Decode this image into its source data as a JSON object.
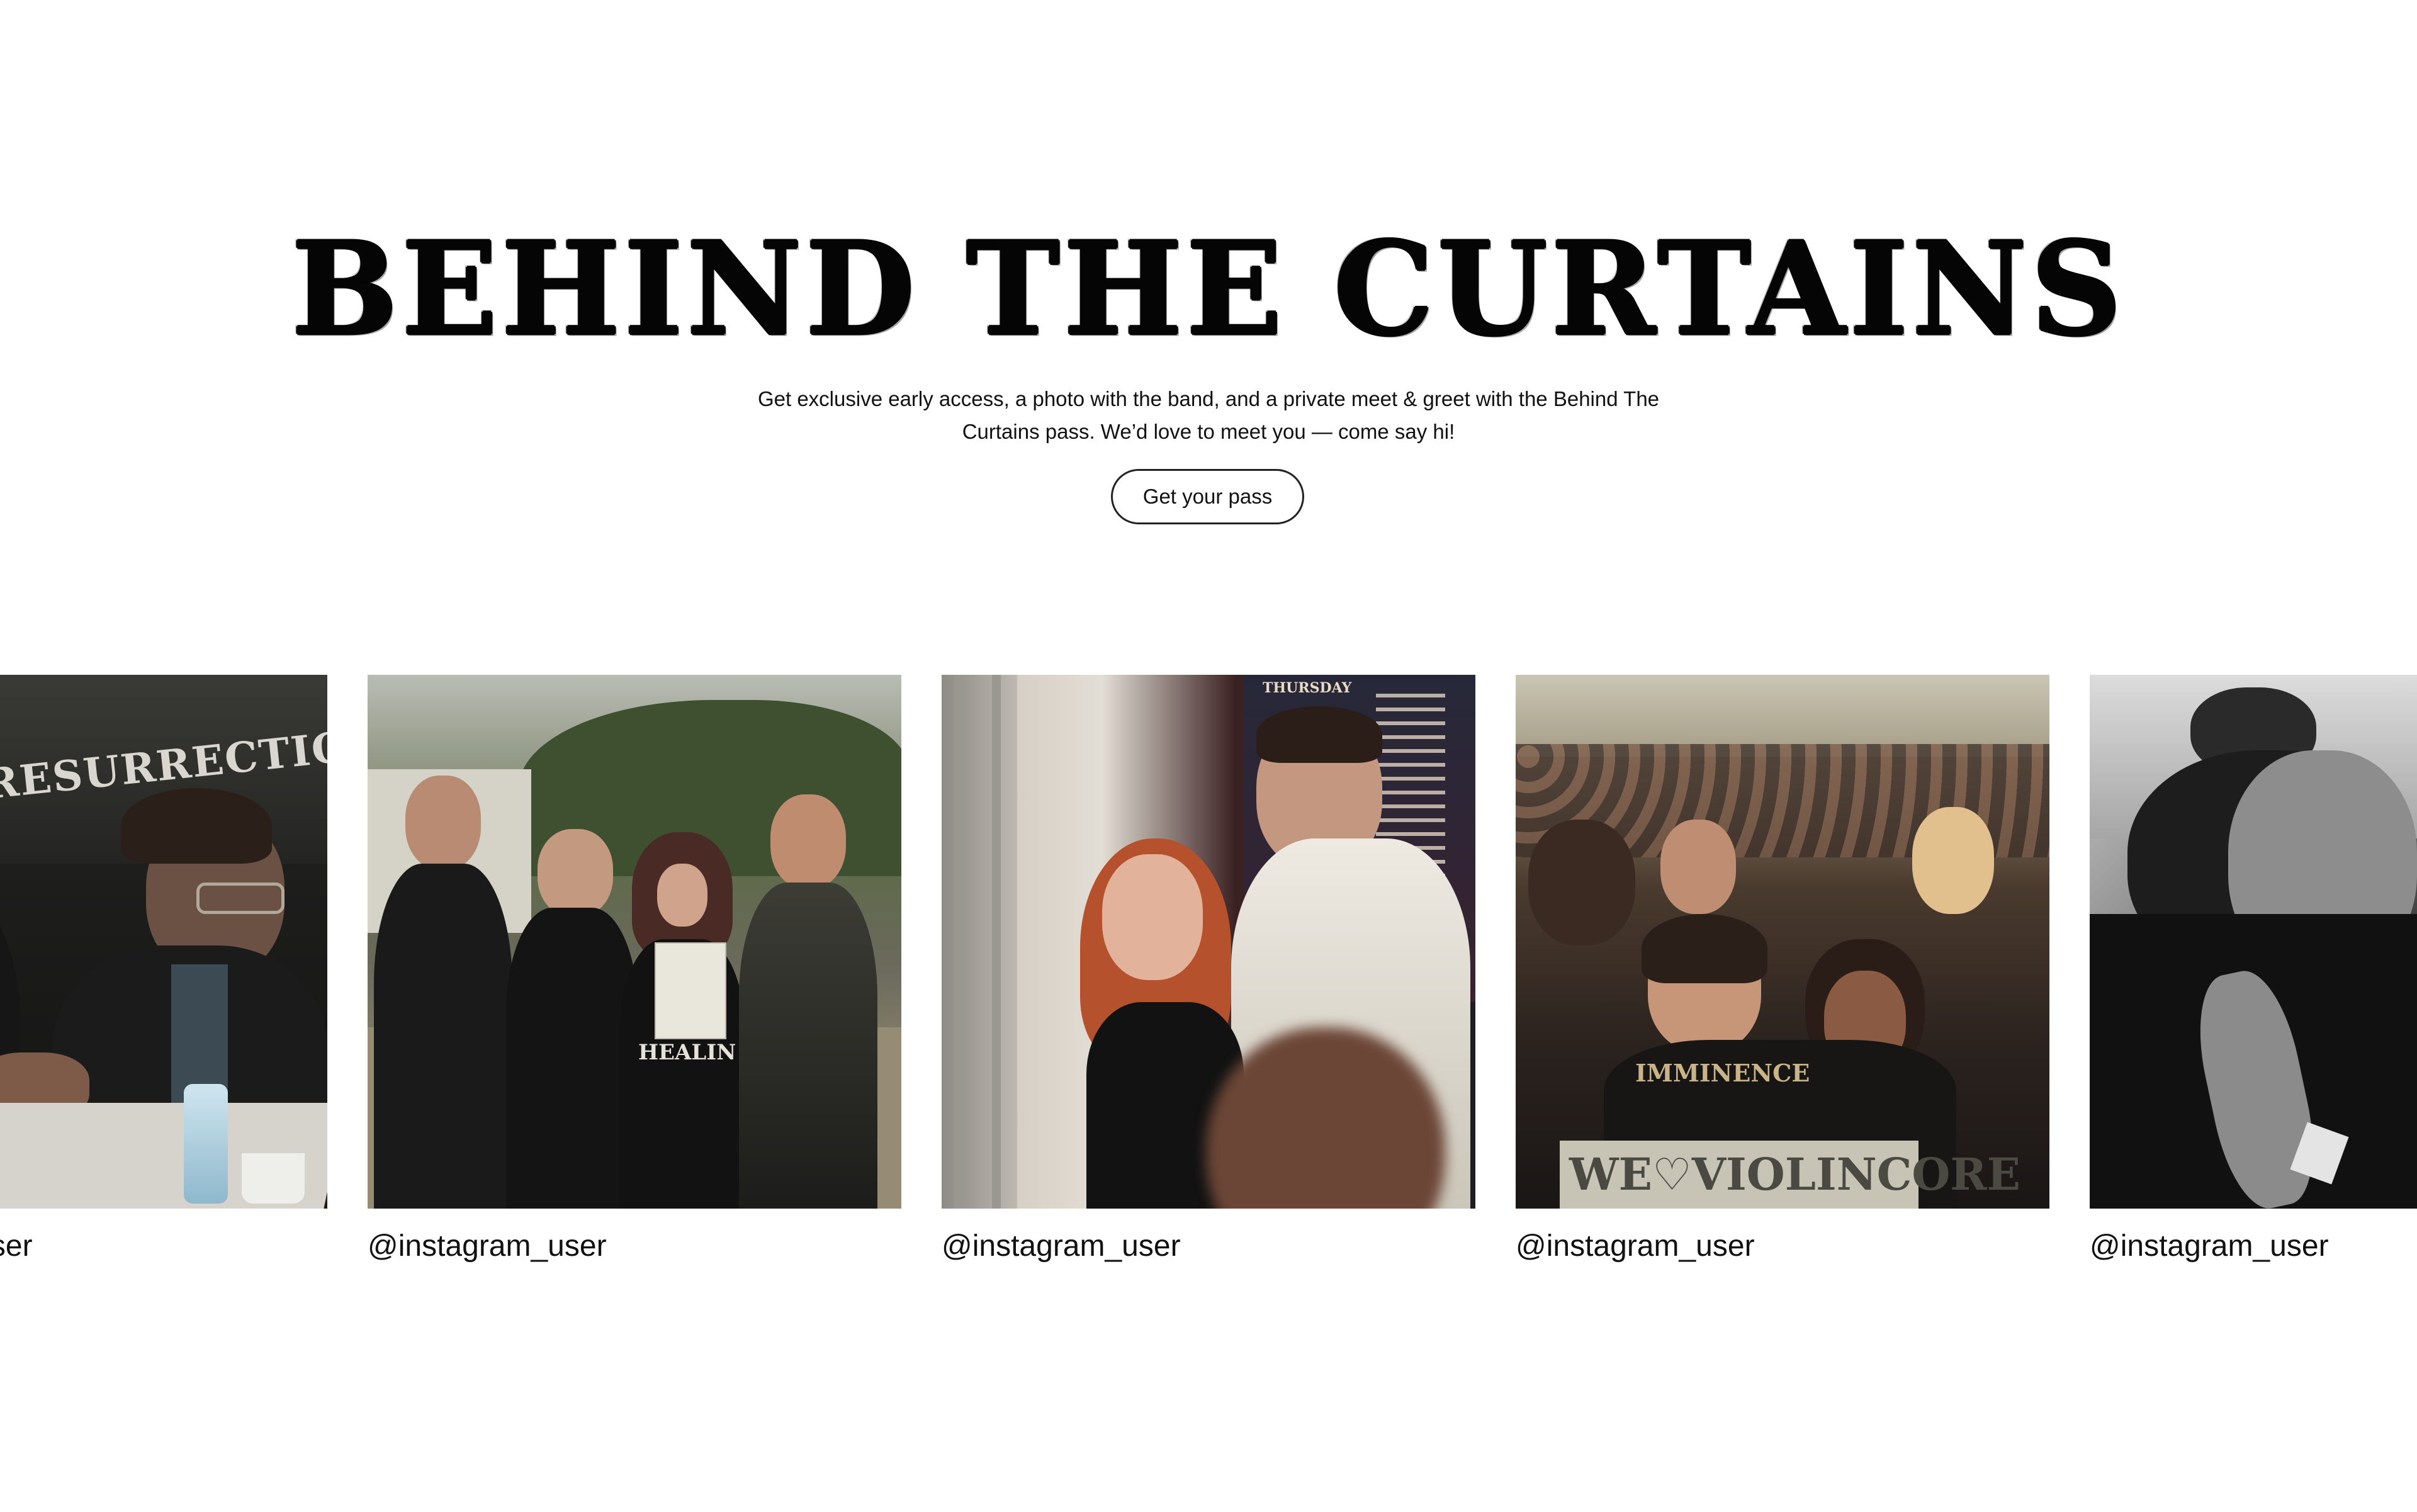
{
  "hero": {
    "title": "BEHIND THE CURTAINS",
    "description": "Get exclusive early access, a photo with the band, and a private meet & greet with the Behind The Curtains pass. We’d love to meet you — come say hi!",
    "cta_label": "Get your pass"
  },
  "gallery": {
    "items": [
      {
        "caption": "@instagram_user",
        "photo_text": "RESURRECTION FEST  Estr"
      },
      {
        "caption": "@instagram_user",
        "photo_text": "HEALIN"
      },
      {
        "caption": "@instagram_user",
        "photo_text": "THURSDAY"
      },
      {
        "caption": "@instagram_user",
        "photo_text": "WE♡VIOLINCORE",
        "photo_text_2": "IMMINENCE"
      },
      {
        "caption": "@instagram_user"
      }
    ]
  }
}
